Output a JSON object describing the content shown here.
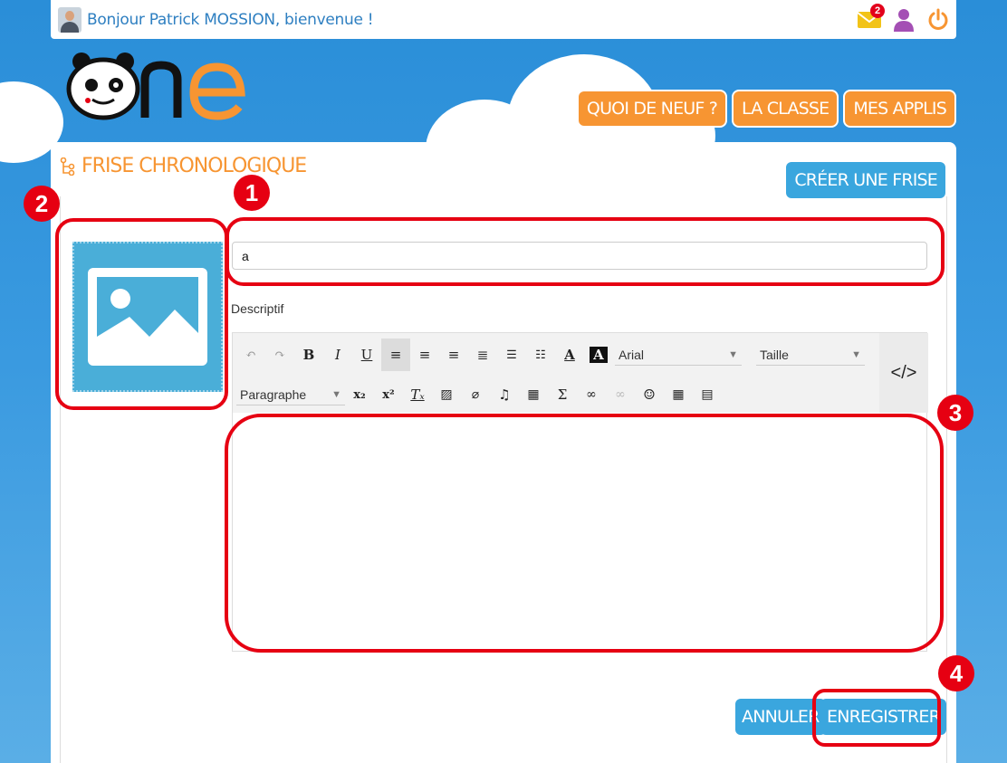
{
  "topbar": {
    "greeting": "Bonjour Patrick MOSSION, bienvenue !",
    "mail_count": "2"
  },
  "nav": {
    "items": [
      "QUOI DE NEUF ?",
      "LA CLASSE",
      "MES APPLIS"
    ]
  },
  "page": {
    "title": "FRISE CHRONOLOGIQUE",
    "create_button": "CRÉER UNE FRISE"
  },
  "form": {
    "title_value": "a",
    "description_label": "Descriptif",
    "font_family": "Arial",
    "font_size": "Taille",
    "block_format": "Paragraphe",
    "cancel_button": "ANNULER",
    "save_button": "ENREGISTRER"
  },
  "annotations": [
    "1",
    "2",
    "3",
    "4"
  ],
  "colors": {
    "accent_orange": "#f79532",
    "accent_blue": "#3aa6de",
    "annotation_red": "#e60012"
  }
}
